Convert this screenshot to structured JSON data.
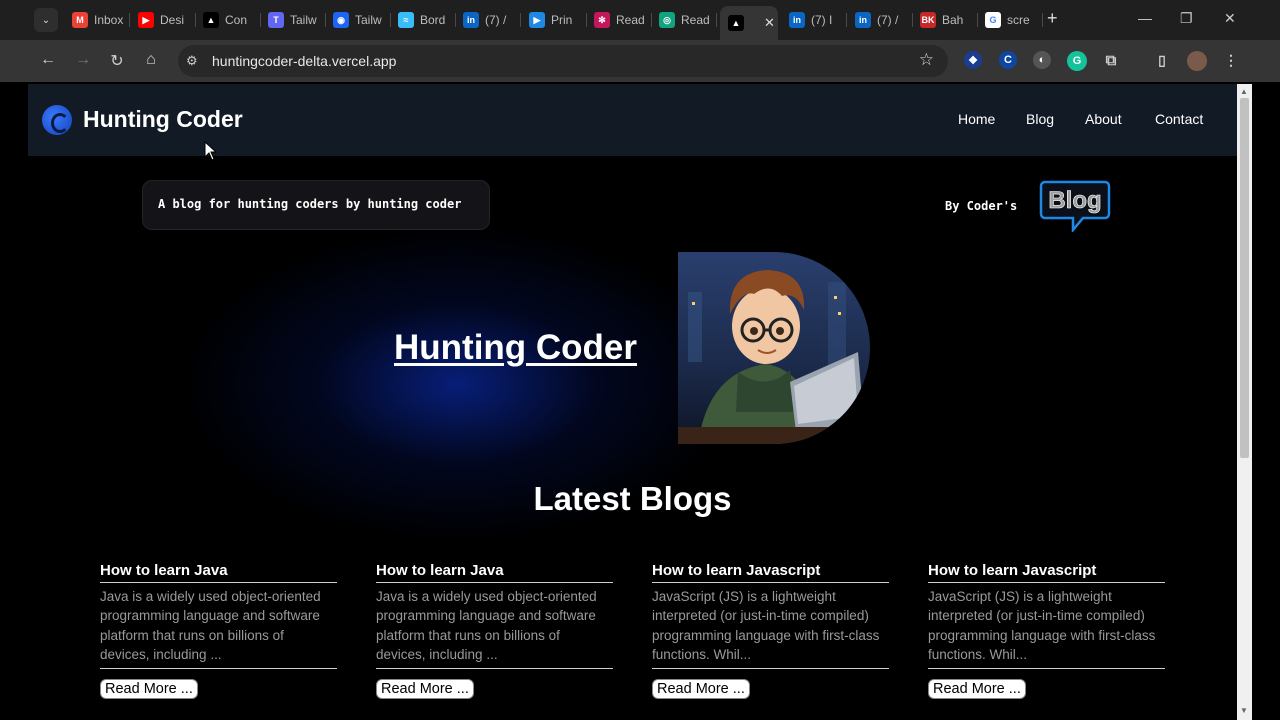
{
  "browser": {
    "tabs": [
      {
        "label": "Inbox",
        "icon": "gmail-icon",
        "color": "#ea4335",
        "glyph": "M"
      },
      {
        "label": "Desi",
        "icon": "youtube-icon",
        "color": "#ff0000",
        "glyph": "▶"
      },
      {
        "label": "Con",
        "icon": "vercel-icon",
        "color": "#000000",
        "glyph": "▲"
      },
      {
        "label": "Tailw",
        "icon": "tailwind-ui-icon",
        "color": "#6366f1",
        "glyph": "T"
      },
      {
        "label": "Tailw",
        "icon": "flowbite-icon",
        "color": "#1c64f2",
        "glyph": "◉"
      },
      {
        "label": "Bord",
        "icon": "tailwind-icon",
        "color": "#38bdf8",
        "glyph": "≈"
      },
      {
        "label": "(7) /",
        "icon": "linkedin-icon",
        "color": "#0a66c2",
        "glyph": "in"
      },
      {
        "label": "Prin",
        "icon": "play-icon",
        "color": "#1e88e5",
        "glyph": "▶"
      },
      {
        "label": "Read",
        "icon": "react-icon",
        "color": "#c2185b",
        "glyph": "✻"
      },
      {
        "label": "Read",
        "icon": "chatgpt-icon",
        "color": "#10a37f",
        "glyph": "◎"
      },
      {
        "label": "",
        "icon": "vercel-icon",
        "color": "#000000",
        "glyph": "▲",
        "active": true
      },
      {
        "label": "(7) I",
        "icon": "linkedin-icon",
        "color": "#0a66c2",
        "glyph": "in"
      },
      {
        "label": "(7) /",
        "icon": "linkedin-icon",
        "color": "#0a66c2",
        "glyph": "in"
      },
      {
        "label": "Bah",
        "icon": "bk-icon",
        "color": "#c62828",
        "glyph": "BK"
      },
      {
        "label": "scre",
        "icon": "google-icon",
        "color": "#ffffff",
        "glyph": "G"
      }
    ],
    "url": "huntingcoder-delta.vercel.app"
  },
  "site": {
    "brand": "Hunting Coder",
    "nav": [
      "Home",
      "Blog",
      "About",
      "Contact"
    ],
    "tagline": "A blog for hunting coders by hunting coder",
    "by_text": "By Coder's",
    "badge_text": "Blog",
    "hero_title": "Hunting Coder",
    "section_title": "Latest Blogs",
    "blogs": [
      {
        "title": "How to learn Java",
        "desc": "Java is a widely used object-oriented programming language and software platform that runs on billions of devices, including ...",
        "button": "Read More ..."
      },
      {
        "title": "How to learn Java",
        "desc": "Java is a widely used object-oriented programming language and software platform that runs on billions of devices, including ...",
        "button": "Read More ..."
      },
      {
        "title": "How to learn Javascript",
        "desc": "JavaScript (JS) is a lightweight interpreted (or just-in-time compiled) programming language with first-class functions. Whil...",
        "button": "Read More ..."
      },
      {
        "title": "How to learn Javascript",
        "desc": "JavaScript (JS) is a lightweight interpreted (or just-in-time compiled) programming language with first-class functions. Whil...",
        "button": "Read More ..."
      }
    ]
  },
  "colors": {
    "nav_bg": "#121a26",
    "accent": "#1e6bff",
    "badge_border": "#1e88e5"
  }
}
